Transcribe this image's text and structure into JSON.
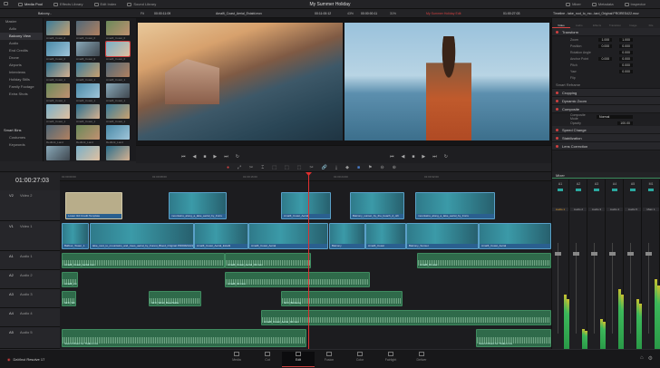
{
  "topbar": {
    "tabs": [
      {
        "label": "Media Pool",
        "icon": "media-pool-icon"
      },
      {
        "label": "Effects Library",
        "icon": "effects-icon"
      },
      {
        "label": "Edit Index",
        "icon": "edit-index-icon"
      },
      {
        "label": "Sound Library",
        "icon": "sound-library-icon"
      }
    ],
    "project_title": "My Summer Holiday",
    "right_tabs": [
      {
        "label": "Mixer",
        "icon": "mixer-icon"
      },
      {
        "label": "Metadata",
        "icon": "metadata-icon"
      },
      {
        "label": "Inspector",
        "icon": "inspector-icon"
      }
    ]
  },
  "toolbar": {
    "bin_dropdown": "Balcony...",
    "fit": "Fit",
    "source_timecode": "00:00:11:09",
    "source_clip": "Amalfi_Coast_Aerial_Establ.mov",
    "source_duration": "00:11:00:12",
    "zoom": "43%",
    "timeline_timecode": "00:00:00:11",
    "timeline_zoom": "31%",
    "timeline_name": "My Summer Holiday Edit",
    "record_timecode": "01:00:27:03",
    "inspector_file": "Timeline - take_root_to_mo...tard_Original PRORES422.mov"
  },
  "bins": {
    "master": "Master",
    "items": [
      "Adlo",
      "Balcony View",
      "Audio",
      "End Credits",
      "Drone",
      "Airports",
      "Interviews",
      "Holiday Stills",
      "Family Footage",
      "Extra Shots"
    ],
    "selected": 1,
    "smart_bins_title": "Smart Bins",
    "smart_bins": [
      "Costumes",
      "Keywords"
    ]
  },
  "thumbnails": [
    "Amalfi_Coast_0",
    "Amalfi_Coast_0",
    "Amalfi_Coast_0",
    "Amalfi_Coast_0",
    "Amalfi_Coast_0",
    "Amalfi_Coast_0",
    "Amalfi_Coast_1",
    "Amalfi_Coast_1",
    "Amalfi_Coast_1",
    "Amalfi_Coast_1",
    "Amalfi_Coast_1",
    "Amalfi_Coast_1",
    "Amalfi_Coast_1",
    "Amalfi_Coast_1",
    "Amalfi_Coast_1",
    "Redfork_Land",
    "Redfork_Land",
    "Redfork_Land",
    "Redfork_Land",
    "Redfork_Land",
    "Redfork_Land"
  ],
  "thumb_selected": 5,
  "inspector": {
    "tabs": [
      "Video",
      "Audio",
      "Effects",
      "Transition",
      "Image",
      "File"
    ],
    "transform": {
      "title": "Transform",
      "params": [
        {
          "label": "Zoom",
          "x": "1.000",
          "y": "1.000"
        },
        {
          "label": "Position",
          "x": "0.000",
          "y": "0.000"
        },
        {
          "label": "Rotation Angle",
          "x": "",
          "y": "0.000"
        },
        {
          "label": "Anchor Point",
          "x": "0.000",
          "y": "0.000"
        },
        {
          "label": "Pitch",
          "x": "",
          "y": "0.000"
        },
        {
          "label": "Yaw",
          "x": "",
          "y": "0.000"
        },
        {
          "label": "Flip",
          "x": "",
          "y": ""
        }
      ]
    },
    "smart_reframe": "Smart Reframe",
    "sections": [
      "Cropping",
      "Dynamic Zoom",
      "Composite"
    ],
    "composite_mode_label": "Composite Mode",
    "composite_mode": "Normal",
    "opacity_label": "Opacity",
    "opacity": "100.00",
    "sections2": [
      "Speed Change",
      "Stabilization",
      "Lens Correction"
    ]
  },
  "timeline": {
    "timecode": "01:00:27:03",
    "ruler": [
      "01:00:00:00",
      "01:00:08:00",
      "01:00:16:00",
      "01:00:24:00",
      "01:00:32:00"
    ],
    "tracks": [
      {
        "id": "V2",
        "name": "Video 2"
      },
      {
        "id": "V1",
        "name": "Video 1"
      },
      {
        "id": "A1",
        "name": "Audio 1"
      },
      {
        "id": "A2",
        "name": "Audio 2"
      },
      {
        "id": "A3",
        "name": "Audio 3"
      },
      {
        "id": "A4",
        "name": "Audio 4"
      },
      {
        "id": "A5",
        "name": "Audio 5"
      }
    ],
    "v2_clips": [
      "Lower 3rd Credit Template",
      "mountains_along_a_lake_aerial_by_Forre",
      "Amalfi_Coast_Aerial",
      "Balcony_sunset_by_the_beach_d_oth",
      "mountains_along_a_lake_aerial_by_Forre"
    ],
    "v1_clips": [
      "Balfour_Tower_1",
      "lake_next_to_mountains_and_trees_aerial_by_Forest_Blood_Original PRORES422",
      "Amalfi_Coast_Aerial_Establ",
      "Amalfi_Coast_Aerial",
      "Balcony",
      "Amalfi_Coast",
      "Balcony_Sunset",
      "Amalfi_Coast_Aerial"
    ],
    "a1_clips": [
      "Amalfi_Coast_Aerial.mov",
      "Amalfi_Coast_Aerial_01.mov",
      "Amalfi_01.wav"
    ],
    "a2_clips": [
      "Amalfi_2.mov",
      "Amalfi_02.mov"
    ],
    "a3_clips": [
      "SFX_Wind_Beachside",
      "SFX_Wind_Beachside",
      "SFX_Birdsong"
    ],
    "a4_clips": [
      "Amalfi_Coast_Aerial_02.mov"
    ],
    "a5_clips": [
      "Sound Music for Trailer.mov",
      "Sound Music for Trailer.mov"
    ]
  },
  "mixer": {
    "title": "Mixer",
    "strips": [
      "A1",
      "A2",
      "A3",
      "A4",
      "A5",
      "M1"
    ],
    "names": [
      "Audio 1",
      "Audio 2",
      "Audio 3",
      "Audio 4",
      "Audio 5",
      "Main 1"
    ],
    "levels": [
      0.55,
      0.2,
      0.3,
      0.6,
      0.5,
      0.7
    ]
  },
  "pages": {
    "items": [
      "Media",
      "Cut",
      "Edit",
      "Fusion",
      "Color",
      "Fairlight",
      "Deliver"
    ],
    "selected": 2,
    "app_name": "DaVinci Resolve 17"
  },
  "colors": {
    "accent": "#d04040",
    "video_clip": "#2a5f8f",
    "audio_clip": "#2f6a4a",
    "playhead": "#e03030"
  }
}
